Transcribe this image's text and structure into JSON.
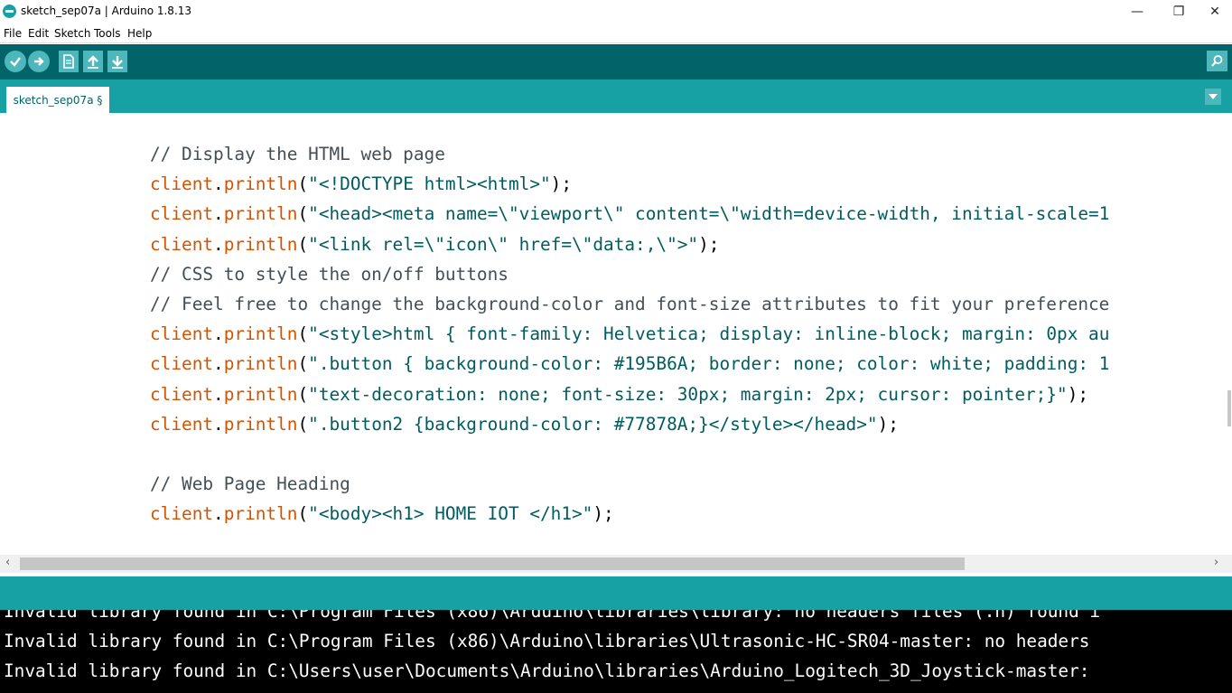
{
  "window": {
    "title": "sketch_sep07a | Arduino 1.8.13",
    "minimize_glyph": "—",
    "maximize_glyph": "❐",
    "close_glyph": "✕"
  },
  "menu": {
    "items": [
      {
        "label": "File"
      },
      {
        "label": "Edit"
      },
      {
        "label": "Sketch"
      },
      {
        "label": "Tools"
      },
      {
        "label": "Help"
      }
    ]
  },
  "toolbar": {
    "buttons": [
      {
        "name": "verify",
        "icon": "check-icon"
      },
      {
        "name": "upload",
        "icon": "arrow-right-icon"
      },
      {
        "name": "new",
        "icon": "new-file-icon"
      },
      {
        "name": "open",
        "icon": "arrow-up-icon"
      },
      {
        "name": "save",
        "icon": "arrow-down-icon"
      }
    ],
    "serial_monitor_icon": "magnifier-icon"
  },
  "tabs": {
    "active": "sketch_sep07a §",
    "menu_icon": "triangle-down-icon"
  },
  "editor": {
    "lines": [
      [
        {
          "t": "// Display the HTML web page",
          "c": "cmt"
        }
      ],
      [
        {
          "t": "client",
          "c": "obj"
        },
        {
          "t": ".",
          "c": "plain"
        },
        {
          "t": "println",
          "c": "fn"
        },
        {
          "t": "(",
          "c": "plain"
        },
        {
          "t": "\"<!DOCTYPE html><html>\"",
          "c": "str"
        },
        {
          "t": ");",
          "c": "plain"
        }
      ],
      [
        {
          "t": "client",
          "c": "obj"
        },
        {
          "t": ".",
          "c": "plain"
        },
        {
          "t": "println",
          "c": "fn"
        },
        {
          "t": "(",
          "c": "plain"
        },
        {
          "t": "\"<head><meta name=\\\"viewport\\\" content=\\\"width=device-width, initial-scale=1",
          "c": "str"
        }
      ],
      [
        {
          "t": "client",
          "c": "obj"
        },
        {
          "t": ".",
          "c": "plain"
        },
        {
          "t": "println",
          "c": "fn"
        },
        {
          "t": "(",
          "c": "plain"
        },
        {
          "t": "\"<link rel=\\\"icon\\\" href=\\\"data:,\\\">\"",
          "c": "str"
        },
        {
          "t": ");",
          "c": "plain"
        }
      ],
      [
        {
          "t": "// CSS to style the on/off buttons",
          "c": "cmt"
        }
      ],
      [
        {
          "t": "// Feel free to change the background-color and font-size attributes to fit your preference",
          "c": "cmt"
        }
      ],
      [
        {
          "t": "client",
          "c": "obj"
        },
        {
          "t": ".",
          "c": "plain"
        },
        {
          "t": "println",
          "c": "fn"
        },
        {
          "t": "(",
          "c": "plain"
        },
        {
          "t": "\"<style>html { font-family: Helvetica; display: inline-block; margin: 0px au",
          "c": "str"
        }
      ],
      [
        {
          "t": "client",
          "c": "obj"
        },
        {
          "t": ".",
          "c": "plain"
        },
        {
          "t": "println",
          "c": "fn"
        },
        {
          "t": "(",
          "c": "plain"
        },
        {
          "t": "\".button { background-color: #195B6A; border: none; color: white; padding: 1",
          "c": "str"
        }
      ],
      [
        {
          "t": "client",
          "c": "obj"
        },
        {
          "t": ".",
          "c": "plain"
        },
        {
          "t": "println",
          "c": "fn"
        },
        {
          "t": "(",
          "c": "plain"
        },
        {
          "t": "\"text-decoration: none; font-size: 30px; margin: 2px; cursor: pointer;}\"",
          "c": "str"
        },
        {
          "t": ");",
          "c": "plain"
        }
      ],
      [
        {
          "t": "client",
          "c": "obj"
        },
        {
          "t": ".",
          "c": "plain"
        },
        {
          "t": "println",
          "c": "fn"
        },
        {
          "t": "(",
          "c": "plain"
        },
        {
          "t": "\".button2 {background-color: #77878A;}</style></head>\"",
          "c": "str"
        },
        {
          "t": ");",
          "c": "plain"
        }
      ],
      [],
      [
        {
          "t": "// Web Page Heading",
          "c": "cmt"
        }
      ],
      [
        {
          "t": "client",
          "c": "obj"
        },
        {
          "t": ".",
          "c": "plain"
        },
        {
          "t": "println",
          "c": "fn"
        },
        {
          "t": "(",
          "c": "plain"
        },
        {
          "t": "\"<body><h1> HOME IOT </h1>\"",
          "c": "str"
        },
        {
          "t": ");",
          "c": "plain"
        }
      ]
    ]
  },
  "scrollbar": {
    "left_arrow": "‹",
    "right_arrow": "›"
  },
  "console": {
    "lines": [
      "Invalid library found in C:\\Program Files (x86)\\Arduino\\libraries\\library: no headers files (.h) found i",
      "Invalid library found in C:\\Program Files (x86)\\Arduino\\libraries\\Ultrasonic-HC-SR04-master: no headers",
      "Invalid library found in C:\\Users\\user\\Documents\\Arduino\\libraries\\Arduino_Logitech_3D_Joystick-master:"
    ]
  },
  "colors": {
    "toolbar": "#006468",
    "tabbar": "#17a1a5",
    "button": "#4db7bb",
    "keyword": "#d35400",
    "string": "#005c5f",
    "comment": "#434f54"
  }
}
